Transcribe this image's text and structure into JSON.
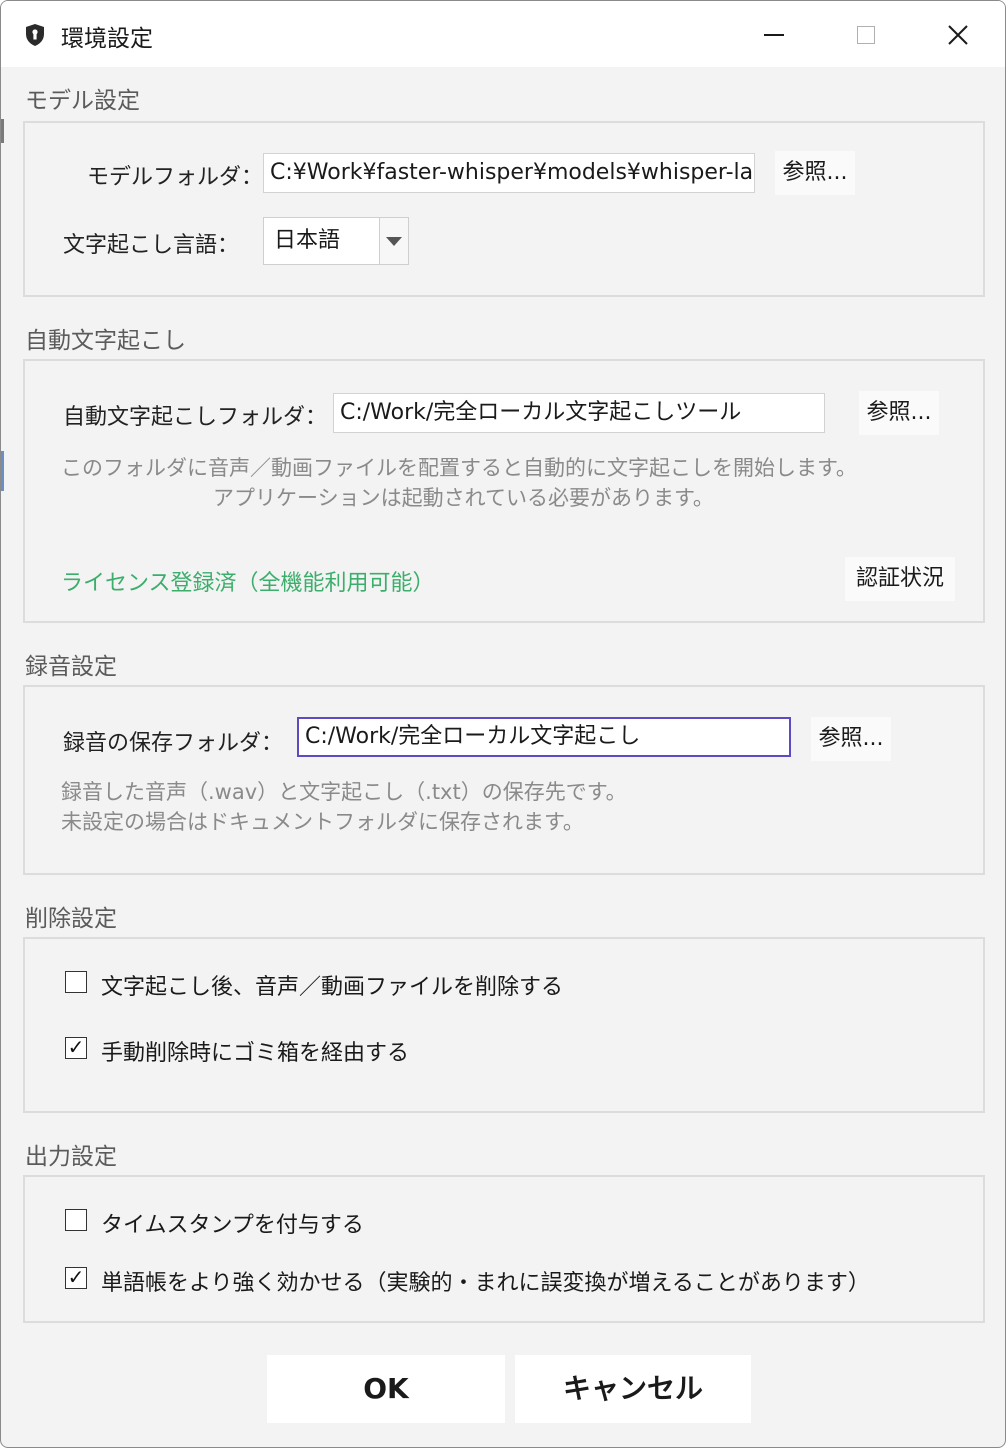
{
  "window": {
    "title": "環境設定",
    "icon": "shield-app-icon",
    "controls": [
      "minimize-icon",
      "maximize-icon",
      "close-icon"
    ]
  },
  "model": {
    "section_title": "モデル設定",
    "folder_label": "モデルフォルダ：",
    "folder_value": "C:¥Work¥faster-whisper¥models¥whisper-large",
    "browse_label": "参照...",
    "language_label": "文字起こし言語：",
    "language_value": "日本語"
  },
  "auto": {
    "section_title": "自動文字起こし",
    "folder_label": "自動文字起こしフォルダ：",
    "folder_value": "C:/Work/完全ローカル文字起こしツール",
    "browse_label": "参照...",
    "note_line1": "このフォルダに音声／動画ファイルを配置すると自動的に文字起こしを開始します。",
    "note_line2": "アプリケーションは起動されている必要があります。",
    "license_status": "ライセンス登録済（全機能利用可能）",
    "license_button": "認証状況"
  },
  "recording": {
    "section_title": "録音設定",
    "folder_label": "録音の保存フォルダ：",
    "folder_value": "C:/Work/完全ローカル文字起こし",
    "browse_label": "参照...",
    "note_line1": "録音した音声（.wav）と文字起こし（.txt）の保存先です。",
    "note_line2": "未設定の場合はドキュメントフォルダに保存されます。"
  },
  "delete": {
    "section_title": "削除設定",
    "options": [
      {
        "label": "文字起こし後、音声／動画ファイルを削除する",
        "checked": false
      },
      {
        "label": "手動削除時にゴミ箱を経由する",
        "checked": true
      }
    ]
  },
  "output": {
    "section_title": "出力設定",
    "options": [
      {
        "label": "タイムスタンプを付与する",
        "checked": false
      },
      {
        "label": "単語帳をより強く効かせる（実験的・まれに誤変換が増えることがあります）",
        "checked": true
      }
    ]
  },
  "buttons": {
    "ok": "OK",
    "cancel": "キャンセル"
  },
  "check_mark": "✓",
  "colors": {
    "license_status": "#3cae6c",
    "focus_border": "#5c4bc4"
  }
}
